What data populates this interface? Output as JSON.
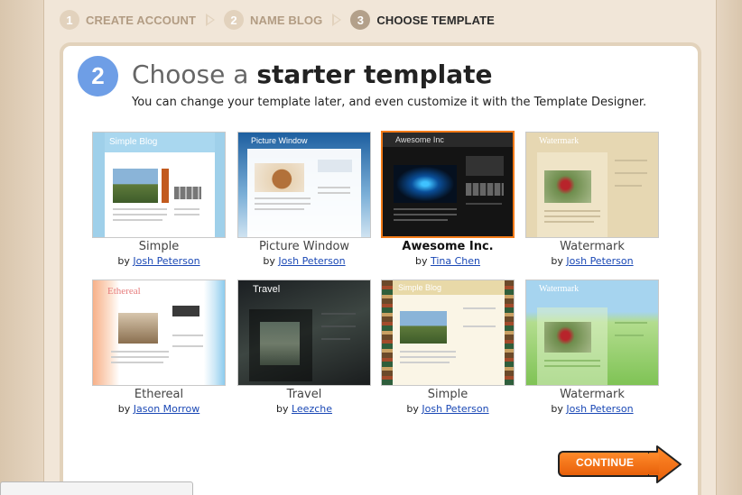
{
  "steps": [
    {
      "num": "1",
      "label": "CREATE ACCOUNT"
    },
    {
      "num": "2",
      "label": "NAME BLOG"
    },
    {
      "num": "3",
      "label": "CHOOSE TEMPLATE"
    }
  ],
  "header": {
    "step_number": "2",
    "title_prefix": "Choose a ",
    "title_strong": "starter template",
    "subtitle": "You can change your template later, and even customize it with the Template Designer."
  },
  "templates": [
    {
      "name": "Simple",
      "by": "by ",
      "author": "Josh Peterson",
      "thumb_title": "Simple Blog",
      "selected": false
    },
    {
      "name": "Picture Window",
      "by": "by ",
      "author": "Josh Peterson",
      "thumb_title": "Picture Window",
      "selected": false
    },
    {
      "name": "Awesome Inc.",
      "by": "by ",
      "author": "Tina Chen",
      "thumb_title": "Awesome Inc",
      "selected": true
    },
    {
      "name": "Watermark",
      "by": "by ",
      "author": "Josh Peterson",
      "thumb_title": "Watermark",
      "selected": false
    },
    {
      "name": "Ethereal",
      "by": "by ",
      "author": "Jason Morrow",
      "thumb_title": "Ethereal",
      "selected": false
    },
    {
      "name": "Travel",
      "by": "by ",
      "author": "Leezche",
      "thumb_title": "Travel",
      "selected": false
    },
    {
      "name": "Simple",
      "by": "by ",
      "author": "Josh Peterson",
      "thumb_title": "Simple Blog",
      "selected": false
    },
    {
      "name": "Watermark",
      "by": "by ",
      "author": "Josh Peterson",
      "thumb_title": "Watermark",
      "selected": false
    }
  ],
  "continue_label": "CONTINUE",
  "colors": {
    "accent_orange": "#f27a17",
    "step_circle_blue": "#6e9ee6",
    "link_blue": "#1a48b5",
    "page_beige": "#f1e6d8"
  }
}
